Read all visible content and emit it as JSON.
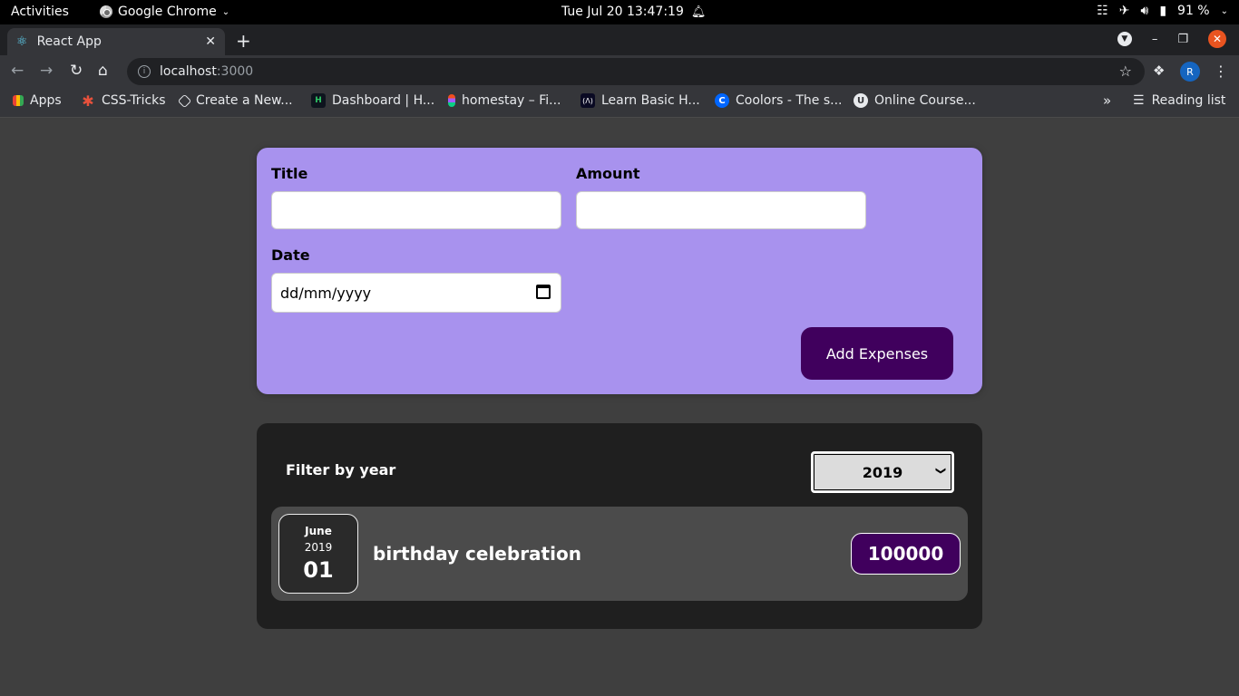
{
  "system_bar": {
    "activities": "Activities",
    "app_name": "Google Chrome",
    "clock": "Tue Jul 20  13:47:19",
    "battery": "91 %"
  },
  "browser": {
    "tab_title": "React App",
    "url_host": "localhost",
    "url_port": ":3000",
    "avatar_letter": "R",
    "bookmarks": [
      {
        "label": "Apps",
        "icon": "apps-grid-icon"
      },
      {
        "label": "CSS-Tricks",
        "icon": "css-tricks-icon"
      },
      {
        "label": "Create a New...",
        "icon": "codepen-icon"
      },
      {
        "label": "Dashboard | H...",
        "icon": "hackerrank-icon"
      },
      {
        "label": "homestay – Fi...",
        "icon": "figma-icon"
      },
      {
        "label": "Learn Basic H...",
        "icon": "freecodecamp-icon"
      },
      {
        "label": "Coolors - The s...",
        "icon": "coolors-icon"
      },
      {
        "label": "Online Course...",
        "icon": "udemy-icon"
      }
    ],
    "reading_list": "Reading list"
  },
  "form": {
    "title_label": "Title",
    "title_value": "",
    "amount_label": "Amount",
    "amount_value": "",
    "date_label": "Date",
    "date_placeholder": "dd/mm/yyyy",
    "submit_label": "Add Expenses"
  },
  "expenses": {
    "filter_label": "Filter by year",
    "selected_year": "2019",
    "items": [
      {
        "month": "June",
        "year": "2019",
        "day": "01",
        "title": "birthday celebration",
        "amount": "100000"
      }
    ]
  },
  "colors": {
    "form_bg": "#a892ee",
    "accent": "#40005d",
    "list_bg": "#1f1f1f",
    "item_bg": "#4b4b4b",
    "page_bg": "#3f3f3f"
  }
}
